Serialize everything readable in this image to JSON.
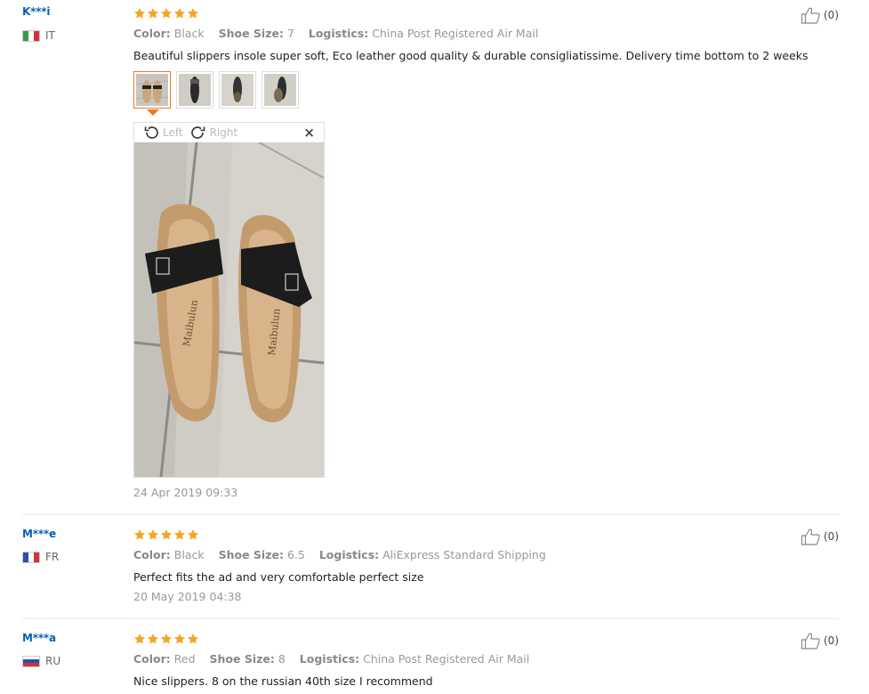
{
  "reviews": [
    {
      "user": "K***i",
      "country": "IT",
      "rating": 5,
      "attrs": [
        {
          "label": "Color:",
          "value": "Black"
        },
        {
          "label": "Shoe Size:",
          "value": "7"
        },
        {
          "label": "Logistics:",
          "value": "China Post Registered Air Mail"
        }
      ],
      "content": "Beautiful slippers insole super soft, Eco leather good quality & durable consigliatissime. Delivery time bottom to 2 weeks",
      "date": "24 Apr 2019 09:33",
      "helpful": "(0)",
      "viewer": {
        "left_label": "Left",
        "right_label": "Right",
        "close": "×"
      }
    },
    {
      "user": "M***e",
      "country": "FR",
      "rating": 5,
      "attrs": [
        {
          "label": "Color:",
          "value": "Black"
        },
        {
          "label": "Shoe Size:",
          "value": "6.5"
        },
        {
          "label": "Logistics:",
          "value": "AliExpress Standard Shipping"
        }
      ],
      "content": "Perfect fits the ad and very comfortable perfect size",
      "date": "20 May 2019 04:38",
      "helpful": "(0)"
    },
    {
      "user": "M***a",
      "country": "RU",
      "rating": 5,
      "attrs": [
        {
          "label": "Color:",
          "value": "Red"
        },
        {
          "label": "Shoe Size:",
          "value": "8"
        },
        {
          "label": "Logistics:",
          "value": "China Post Registered Air Mail"
        }
      ],
      "content": "Nice slippers. 8 on the russian 40th size I recommend",
      "helpful": "(0)"
    }
  ],
  "colors": {
    "star": "#f5a623",
    "user": "#0560b2",
    "active_thumb": "#e67e22"
  },
  "icons": {
    "helpful": "thumbs-up-icon",
    "star": "star-icon",
    "rotate_left": "rotate-left-icon",
    "rotate_right": "rotate-right-icon"
  }
}
